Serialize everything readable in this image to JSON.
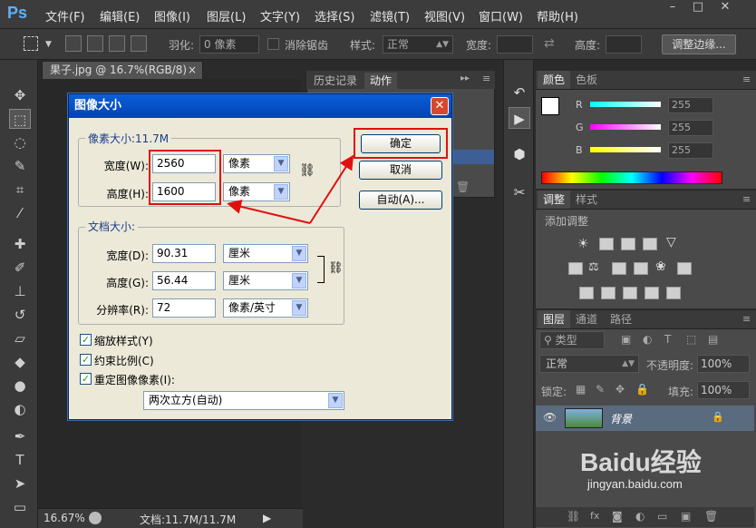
{
  "app": {
    "logo": "Ps",
    "menu": [
      "文件(F)",
      "编辑(E)",
      "图像(I)",
      "图层(L)",
      "文字(Y)",
      "选择(S)",
      "滤镜(T)",
      "视图(V)",
      "窗口(W)",
      "帮助(H)"
    ],
    "window_buttons": [
      "–",
      "□",
      "✕"
    ]
  },
  "options_bar": {
    "feather_label": "羽化:",
    "feather_value": "0 像素",
    "antialias_label": "消除锯齿",
    "style_label": "样式:",
    "style_value": "正常",
    "width_label": "宽度:",
    "height_label": "高度:",
    "refine_button": "调整边缘..."
  },
  "document_tab": {
    "title": "果子.jpg @ 16.7%(RGB/8)",
    "close": "×"
  },
  "status_bar": {
    "zoom": "16.67%",
    "doc_info": "文档:11.7M/11.7M"
  },
  "history_panel": {
    "tabs": [
      "历史记录",
      "动作"
    ]
  },
  "color_panel": {
    "tabs": [
      "颜色",
      "色板"
    ],
    "channels": [
      {
        "label": "R",
        "value": "255",
        "color": "#ff0000"
      },
      {
        "label": "G",
        "value": "255",
        "color": "#00ff00"
      },
      {
        "label": "B",
        "value": "255",
        "color": "#0000ff"
      }
    ]
  },
  "adjust_panel": {
    "tabs": [
      "调整",
      "样式"
    ],
    "subtitle": "添加调整"
  },
  "layers_panel": {
    "tabs": [
      "图层",
      "通道",
      "路径"
    ],
    "filter_label": "类型",
    "blend_mode": "正常",
    "opacity_label": "不透明度:",
    "opacity_value": "100%",
    "lock_label": "锁定:",
    "fill_label": "填充:",
    "fill_value": "100%",
    "layer_name": "背景"
  },
  "dialog": {
    "title": "图像大小",
    "pixel_group_label": "像素大小:11.7M",
    "pixel_width_label": "宽度(W):",
    "pixel_width_value": "2560",
    "pixel_width_unit": "像素",
    "pixel_height_label": "高度(H):",
    "pixel_height_value": "1600",
    "pixel_height_unit": "像素",
    "doc_group_label": "文档大小:",
    "doc_width_label": "宽度(D):",
    "doc_width_value": "90.31",
    "doc_width_unit": "厘米",
    "doc_height_label": "高度(G):",
    "doc_height_value": "56.44",
    "doc_height_unit": "厘米",
    "resolution_label": "分辨率(R):",
    "resolution_value": "72",
    "resolution_unit": "像素/英寸",
    "scale_styles": "缩放样式(Y)",
    "constrain": "约束比例(C)",
    "resample": "重定图像像素(I):",
    "resample_method": "两次立方(自动)",
    "ok_button": "确定",
    "cancel_button": "取消",
    "auto_button": "自动(A)..."
  },
  "watermark": {
    "brand": "Baidu经验",
    "url": "jingyan.baidu.com"
  }
}
